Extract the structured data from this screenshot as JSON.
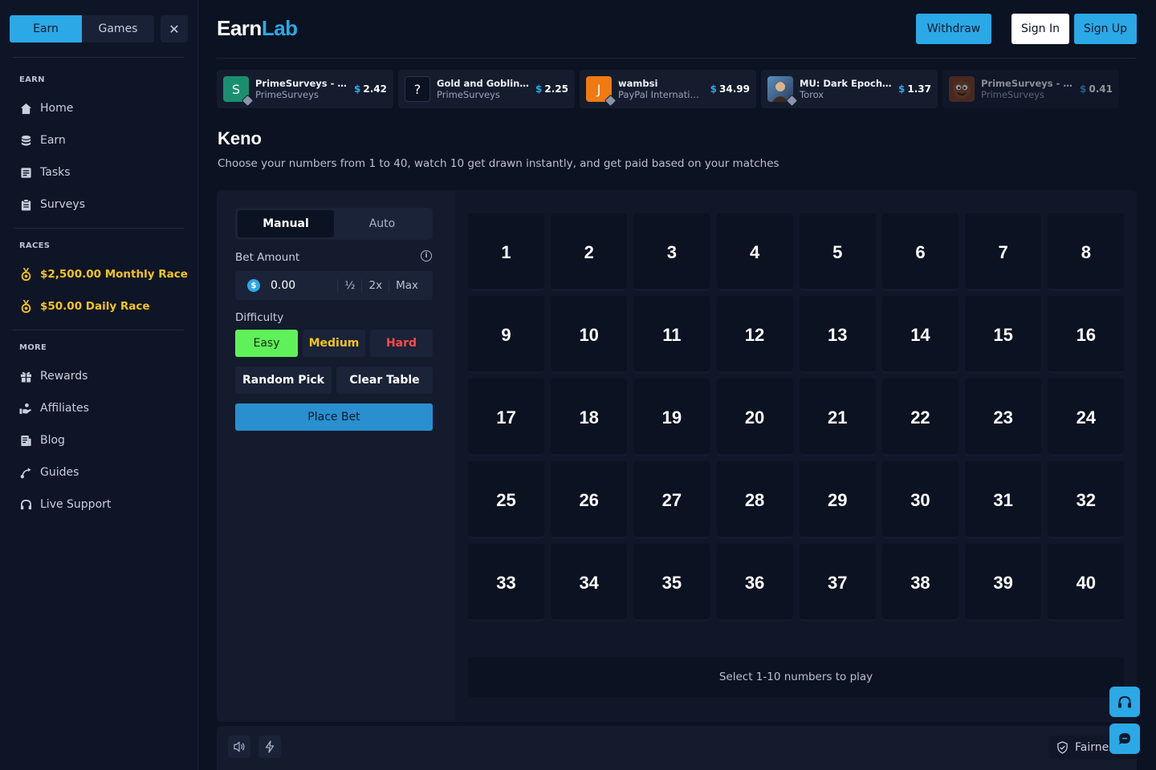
{
  "sidebar": {
    "tabs": {
      "earn": "Earn",
      "games": "Games"
    },
    "close": "✕",
    "sections": {
      "earn": "EARN",
      "races": "RACES",
      "more": "MORE"
    },
    "earn_items": [
      {
        "label": "Home",
        "icon": "home-icon"
      },
      {
        "label": "Earn",
        "icon": "coins-icon"
      },
      {
        "label": "Tasks",
        "icon": "tasks-icon"
      },
      {
        "label": "Surveys",
        "icon": "clipboard-icon"
      }
    ],
    "races": [
      {
        "label": "$2,500.00 Monthly Race",
        "icon": "medal-icon"
      },
      {
        "label": "$50.00 Daily Race",
        "icon": "medal-icon"
      }
    ],
    "more_items": [
      {
        "label": "Rewards",
        "icon": "gift-icon"
      },
      {
        "label": "Affiliates",
        "icon": "affiliates-icon"
      },
      {
        "label": "Blog",
        "icon": "blog-icon"
      },
      {
        "label": "Guides",
        "icon": "guides-icon"
      },
      {
        "label": "Live Support",
        "icon": "headset-icon"
      }
    ]
  },
  "header": {
    "logo_earn": "Earn",
    "logo_lab": "Lab",
    "withdraw": "Withdraw",
    "sign_in": "Sign In",
    "sign_up": "Sign Up"
  },
  "ticker": [
    {
      "avatar": "S",
      "avatar_color": "#1a8f6e",
      "title": "PrimeSurveys - Com...",
      "sub": "PrimeSurveys",
      "currency": "$",
      "amount": "2.42"
    },
    {
      "avatar": "?",
      "avatar_color": "#0b1221",
      "title": "Gold and Goblins: Id...",
      "sub": "PrimeSurveys",
      "currency": "$",
      "amount": "2.25"
    },
    {
      "avatar": "J",
      "avatar_color": "#f07a12",
      "title": "wambsi",
      "sub": "PayPal International",
      "currency": "$",
      "amount": "34.99"
    },
    {
      "avatar": "",
      "avatar_color": "#3a6fa8",
      "title": "MU: Dark Epoch - Re...",
      "sub": "Torox",
      "currency": "$",
      "amount": "1.37"
    },
    {
      "avatar": "",
      "avatar_color": "#7a3b1e",
      "title": "PrimeSurveys - Com...",
      "sub": "PrimeSurveys",
      "currency": "$",
      "amount": "0.41"
    }
  ],
  "page": {
    "title": "Keno",
    "subtitle": "Choose your numbers from 1 to 40, watch 10 get drawn instantly, and get paid based on your matches"
  },
  "controls": {
    "modes": {
      "manual": "Manual",
      "auto": "Auto"
    },
    "bet_amount_label": "Bet Amount",
    "bet_value": "0.00",
    "bet_half": "½",
    "bet_double": "2x",
    "bet_max": "Max",
    "difficulty_label": "Difficulty",
    "difficulty": {
      "easy": "Easy",
      "medium": "Medium",
      "hard": "Hard"
    },
    "random_pick": "Random Pick",
    "clear_table": "Clear Table",
    "place_bet": "Place Bet"
  },
  "board": {
    "numbers": [
      1,
      2,
      3,
      4,
      5,
      6,
      7,
      8,
      9,
      10,
      11,
      12,
      13,
      14,
      15,
      16,
      17,
      18,
      19,
      20,
      21,
      22,
      23,
      24,
      25,
      26,
      27,
      28,
      29,
      30,
      31,
      32,
      33,
      34,
      35,
      36,
      37,
      38,
      39,
      40
    ],
    "status": "Select 1-10 numbers to play"
  },
  "footer": {
    "fairness": "Fairness"
  },
  "colors": {
    "accent": "#2ba8e6",
    "race_gold": "#f5c518",
    "easy_green": "#5ff15a",
    "hard_red": "#ff4a4a"
  }
}
